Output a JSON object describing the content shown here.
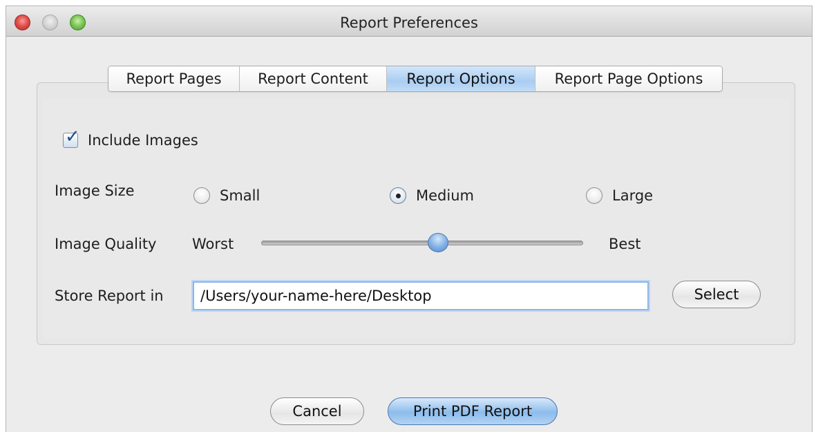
{
  "window": {
    "title": "Report Preferences"
  },
  "tabs": [
    {
      "label": "Report Pages",
      "selected": false
    },
    {
      "label": "Report Content",
      "selected": false
    },
    {
      "label": "Report Options",
      "selected": true
    },
    {
      "label": "Report Page Options",
      "selected": false
    }
  ],
  "include_images": {
    "label": "Include Images",
    "checked": true
  },
  "image_size": {
    "label": "Image Size",
    "options": [
      "Small",
      "Medium",
      "Large"
    ],
    "selected": "Medium"
  },
  "image_quality": {
    "label": "Image Quality",
    "min_label": "Worst",
    "max_label": "Best",
    "value_fraction": 0.55
  },
  "store_report": {
    "label": "Store Report in",
    "value": "/Users/your-name-here/Desktop",
    "button_label": "Select"
  },
  "footer": {
    "cancel_label": "Cancel",
    "print_label": "Print PDF Report"
  },
  "colors": {
    "accent": "#8dbcec",
    "selected_tab": "#a9cdf2",
    "focus_ring": "#8eb6e6"
  }
}
